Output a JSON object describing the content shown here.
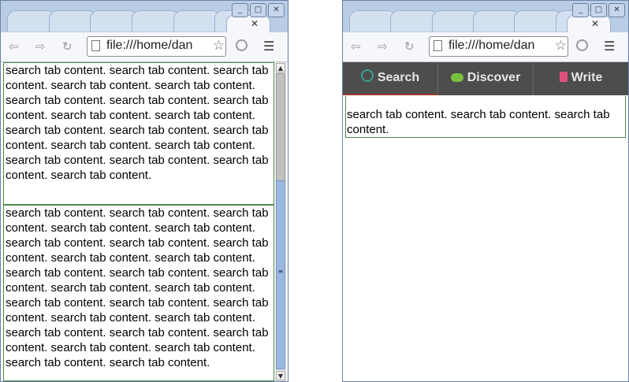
{
  "windows": {
    "left": {
      "address": "file:///home/dan",
      "tab_close": "✕",
      "buttons": {
        "minimize": "_",
        "maximize": "□",
        "close": "✕"
      },
      "pane_top_text": "search tab content. search tab content. search tab content. search tab content. search tab content. search tab content. search tab content. search tab content. search tab content. search tab content. search tab content. search tab content. search tab content. search tab content. search tab content. search tab content. search tab content. search tab content. search tab content.",
      "pane_bottom_text": "search tab content. search tab content. search tab content. search tab content. search tab content. search tab content. search tab content. search tab content. search tab content. search tab content. search tab content. search tab content. search tab content. search tab content. search tab content. search tab content. search tab content. search tab content. search tab content. search tab content. search tab content. search tab content. search tab content. search tab content. search tab content. search tab content. search tab content."
    },
    "right": {
      "address": "file:///home/dan",
      "tab_close": "✕",
      "buttons": {
        "minimize": "_",
        "maximize": "□",
        "close": "✕"
      },
      "tabs": [
        {
          "label": "Search",
          "icon": "search-icon",
          "active": true
        },
        {
          "label": "Discover",
          "icon": "chat-icon",
          "active": false
        },
        {
          "label": "Write",
          "icon": "note-icon",
          "active": false
        }
      ],
      "content_text": "search tab content. search tab content. search tab content."
    }
  },
  "colors": {
    "accent": "#a03a2a",
    "nav_bg": "#4d4d4d",
    "border_green": "#4a8a4a"
  }
}
